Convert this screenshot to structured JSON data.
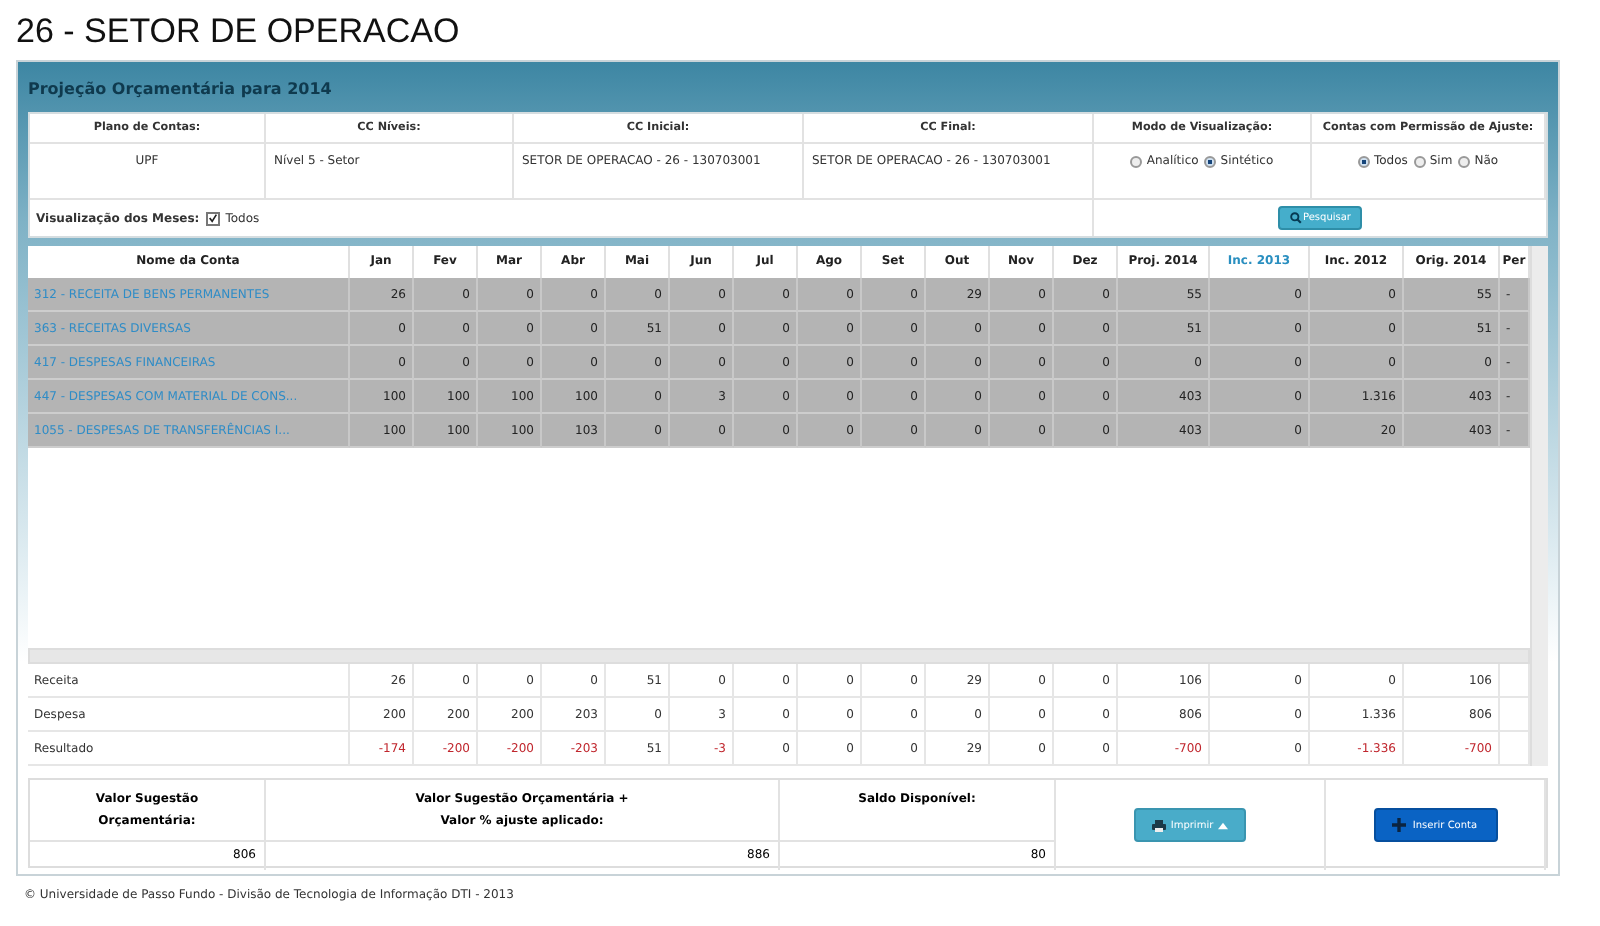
{
  "page_title": "26 - SETOR DE OPERACAO",
  "panel": {
    "title": "Projeção Orçamentária para 2014"
  },
  "filters": {
    "plano": {
      "label": "Plano de Contas:",
      "value": "UPF"
    },
    "niveis": {
      "label": "CC Níveis:",
      "value": "Nível 5 - Setor"
    },
    "inicial": {
      "label": "CC Inicial:",
      "value": "SETOR DE OPERACAO - 26 - 130703001"
    },
    "final": {
      "label": "CC Final:",
      "value": "SETOR DE OPERACAO - 26 - 130703001"
    },
    "modo": {
      "label": "Modo de Visualização:",
      "options": [
        {
          "label": "Analítico",
          "selected": false
        },
        {
          "label": "Sintético",
          "selected": true
        }
      ]
    },
    "contas": {
      "label": "Contas com Permissão de Ajuste:",
      "options": [
        {
          "label": "Todos",
          "selected": true
        },
        {
          "label": "Sim",
          "selected": false
        },
        {
          "label": "Não",
          "selected": false
        }
      ]
    },
    "meses": {
      "label": "Visualização dos Meses:",
      "checkbox": {
        "label": "Todos",
        "checked": true
      }
    },
    "search_button": "Pesquisar"
  },
  "table": {
    "columns": [
      {
        "label": "Nome da Conta",
        "selected": false
      },
      {
        "label": "Jan",
        "selected": false
      },
      {
        "label": "Fev",
        "selected": false
      },
      {
        "label": "Mar",
        "selected": false
      },
      {
        "label": "Abr",
        "selected": false
      },
      {
        "label": "Mai",
        "selected": false
      },
      {
        "label": "Jun",
        "selected": false
      },
      {
        "label": "Jul",
        "selected": false
      },
      {
        "label": "Ago",
        "selected": false
      },
      {
        "label": "Set",
        "selected": false
      },
      {
        "label": "Out",
        "selected": false
      },
      {
        "label": "Nov",
        "selected": false
      },
      {
        "label": "Dez",
        "selected": false
      },
      {
        "label": "Proj. 2014",
        "selected": false
      },
      {
        "label": "Inc. 2013",
        "selected": true
      },
      {
        "label": "Inc. 2012",
        "selected": false
      },
      {
        "label": "Orig. 2014",
        "selected": false
      },
      {
        "label": "Per",
        "selected": false
      }
    ],
    "rows": [
      {
        "name": "312 - RECEITA DE BENS PERMANENTES",
        "values": [
          "26",
          "0",
          "0",
          "0",
          "0",
          "0",
          "0",
          "0",
          "0",
          "29",
          "0",
          "0",
          "55",
          "0",
          "0",
          "55",
          "-"
        ]
      },
      {
        "name": "363 - RECEITAS DIVERSAS",
        "values": [
          "0",
          "0",
          "0",
          "0",
          "51",
          "0",
          "0",
          "0",
          "0",
          "0",
          "0",
          "0",
          "51",
          "0",
          "0",
          "51",
          "-"
        ]
      },
      {
        "name": "417 - DESPESAS FINANCEIRAS",
        "values": [
          "0",
          "0",
          "0",
          "0",
          "0",
          "0",
          "0",
          "0",
          "0",
          "0",
          "0",
          "0",
          "0",
          "0",
          "0",
          "0",
          "-"
        ]
      },
      {
        "name": "447 - DESPESAS COM MATERIAL DE CONS...",
        "values": [
          "100",
          "100",
          "100",
          "100",
          "0",
          "3",
          "0",
          "0",
          "0",
          "0",
          "0",
          "0",
          "403",
          "0",
          "1.316",
          "403",
          "-"
        ]
      },
      {
        "name": "1055 - DESPESAS DE TRANSFERÊNCIAS I...",
        "values": [
          "100",
          "100",
          "100",
          "103",
          "0",
          "0",
          "0",
          "0",
          "0",
          "0",
          "0",
          "0",
          "403",
          "0",
          "20",
          "403",
          "-"
        ]
      }
    ],
    "totals": [
      {
        "label": "Receita",
        "cells": [
          {
            "text": "26",
            "negative": false
          },
          {
            "text": "0",
            "negative": false
          },
          {
            "text": "0",
            "negative": false
          },
          {
            "text": "0",
            "negative": false
          },
          {
            "text": "51",
            "negative": false
          },
          {
            "text": "0",
            "negative": false
          },
          {
            "text": "0",
            "negative": false
          },
          {
            "text": "0",
            "negative": false
          },
          {
            "text": "0",
            "negative": false
          },
          {
            "text": "29",
            "negative": false
          },
          {
            "text": "0",
            "negative": false
          },
          {
            "text": "0",
            "negative": false
          },
          {
            "text": "106",
            "negative": false
          },
          {
            "text": "0",
            "negative": false
          },
          {
            "text": "0",
            "negative": false
          },
          {
            "text": "106",
            "negative": false
          }
        ]
      },
      {
        "label": "Despesa",
        "cells": [
          {
            "text": "200",
            "negative": false
          },
          {
            "text": "200",
            "negative": false
          },
          {
            "text": "200",
            "negative": false
          },
          {
            "text": "203",
            "negative": false
          },
          {
            "text": "0",
            "negative": false
          },
          {
            "text": "3",
            "negative": false
          },
          {
            "text": "0",
            "negative": false
          },
          {
            "text": "0",
            "negative": false
          },
          {
            "text": "0",
            "negative": false
          },
          {
            "text": "0",
            "negative": false
          },
          {
            "text": "0",
            "negative": false
          },
          {
            "text": "0",
            "negative": false
          },
          {
            "text": "806",
            "negative": false
          },
          {
            "text": "0",
            "negative": false
          },
          {
            "text": "1.336",
            "negative": false
          },
          {
            "text": "806",
            "negative": false
          }
        ]
      },
      {
        "label": "Resultado",
        "cells": [
          {
            "text": "-174",
            "negative": true
          },
          {
            "text": "-200",
            "negative": true
          },
          {
            "text": "-200",
            "negative": true
          },
          {
            "text": "-203",
            "negative": true
          },
          {
            "text": "51",
            "negative": false
          },
          {
            "text": "-3",
            "negative": true
          },
          {
            "text": "0",
            "negative": false
          },
          {
            "text": "0",
            "negative": false
          },
          {
            "text": "0",
            "negative": false
          },
          {
            "text": "29",
            "negative": false
          },
          {
            "text": "0",
            "negative": false
          },
          {
            "text": "0",
            "negative": false
          },
          {
            "text": "-700",
            "negative": true
          },
          {
            "text": "0",
            "negative": false
          },
          {
            "text": "-1.336",
            "negative": true
          },
          {
            "text": "-700",
            "negative": true
          }
        ]
      }
    ]
  },
  "summary": {
    "items": [
      {
        "label": "Valor Sugestão Orçamentária:",
        "value": "806"
      },
      {
        "label": "Valor Sugestão Orçamentária + Valor % ajuste aplicado:",
        "value": "886"
      },
      {
        "label": "Saldo Disponível:",
        "value": "80"
      }
    ],
    "print_button": "Imprimir",
    "insert_button": "Inserir Conta"
  },
  "footer": "© Universidade de Passo Fundo - Divisão de Tecnologia de Informação DTI - 2013"
}
